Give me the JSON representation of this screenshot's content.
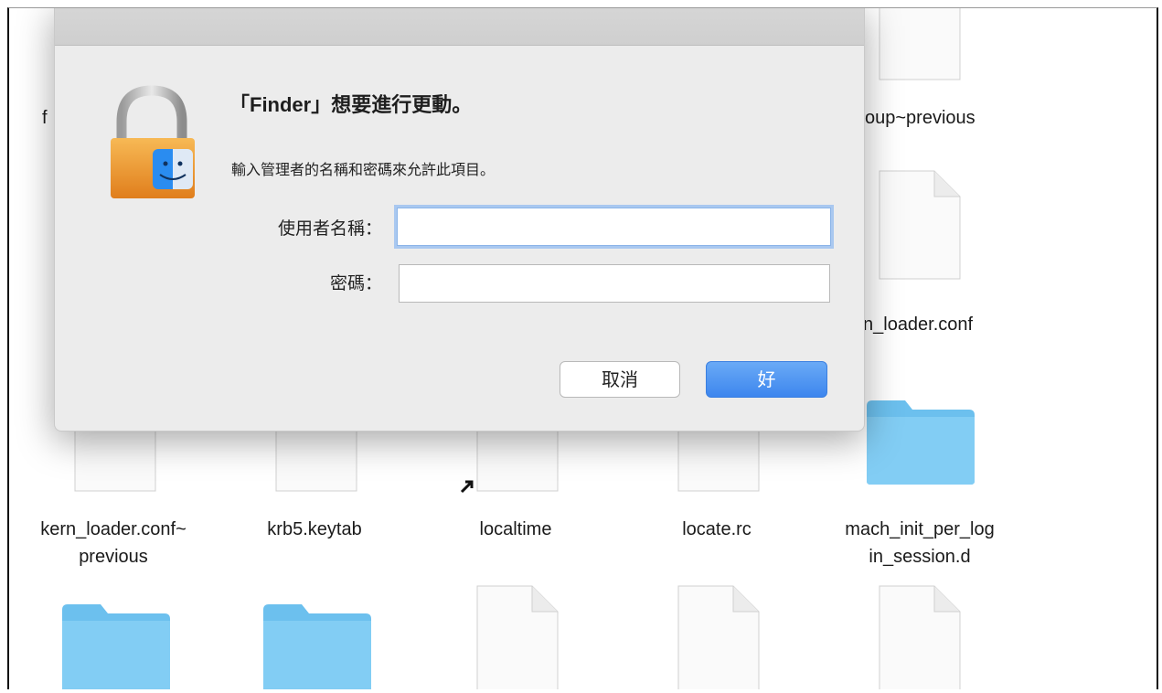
{
  "dialog": {
    "title": "「Finder」想要進行更動。",
    "subtitle": "輸入管理者的名稱和密碼來允許此項目。",
    "username_label": "使用者名稱：",
    "username_value": "",
    "password_label": "密碼：",
    "password_value": "",
    "cancel_label": "取消",
    "ok_label": "好",
    "accent_color": "#3d86ee"
  },
  "finder": {
    "partial_left": "f",
    "top_right_label": "oup~previous",
    "mid_right_label": "n_loader.conf",
    "row_items": [
      {
        "line1": "kern_loader.conf~",
        "line2": "previous",
        "icon": "document-icon"
      },
      {
        "line1": "krb5.keytab",
        "line2": "",
        "icon": "document-icon"
      },
      {
        "line1": "localtime",
        "line2": "",
        "icon": "alias-document-icon"
      },
      {
        "line1": "locate.rc",
        "line2": "",
        "icon": "document-icon"
      },
      {
        "line1": "mach_init_per_log",
        "line2": "in_session.d",
        "icon": "folder-icon"
      }
    ],
    "bottom_items": [
      {
        "icon": "folder-icon"
      },
      {
        "icon": "folder-icon"
      },
      {
        "icon": "document-icon"
      },
      {
        "icon": "document-icon"
      },
      {
        "icon": "document-icon"
      }
    ]
  }
}
